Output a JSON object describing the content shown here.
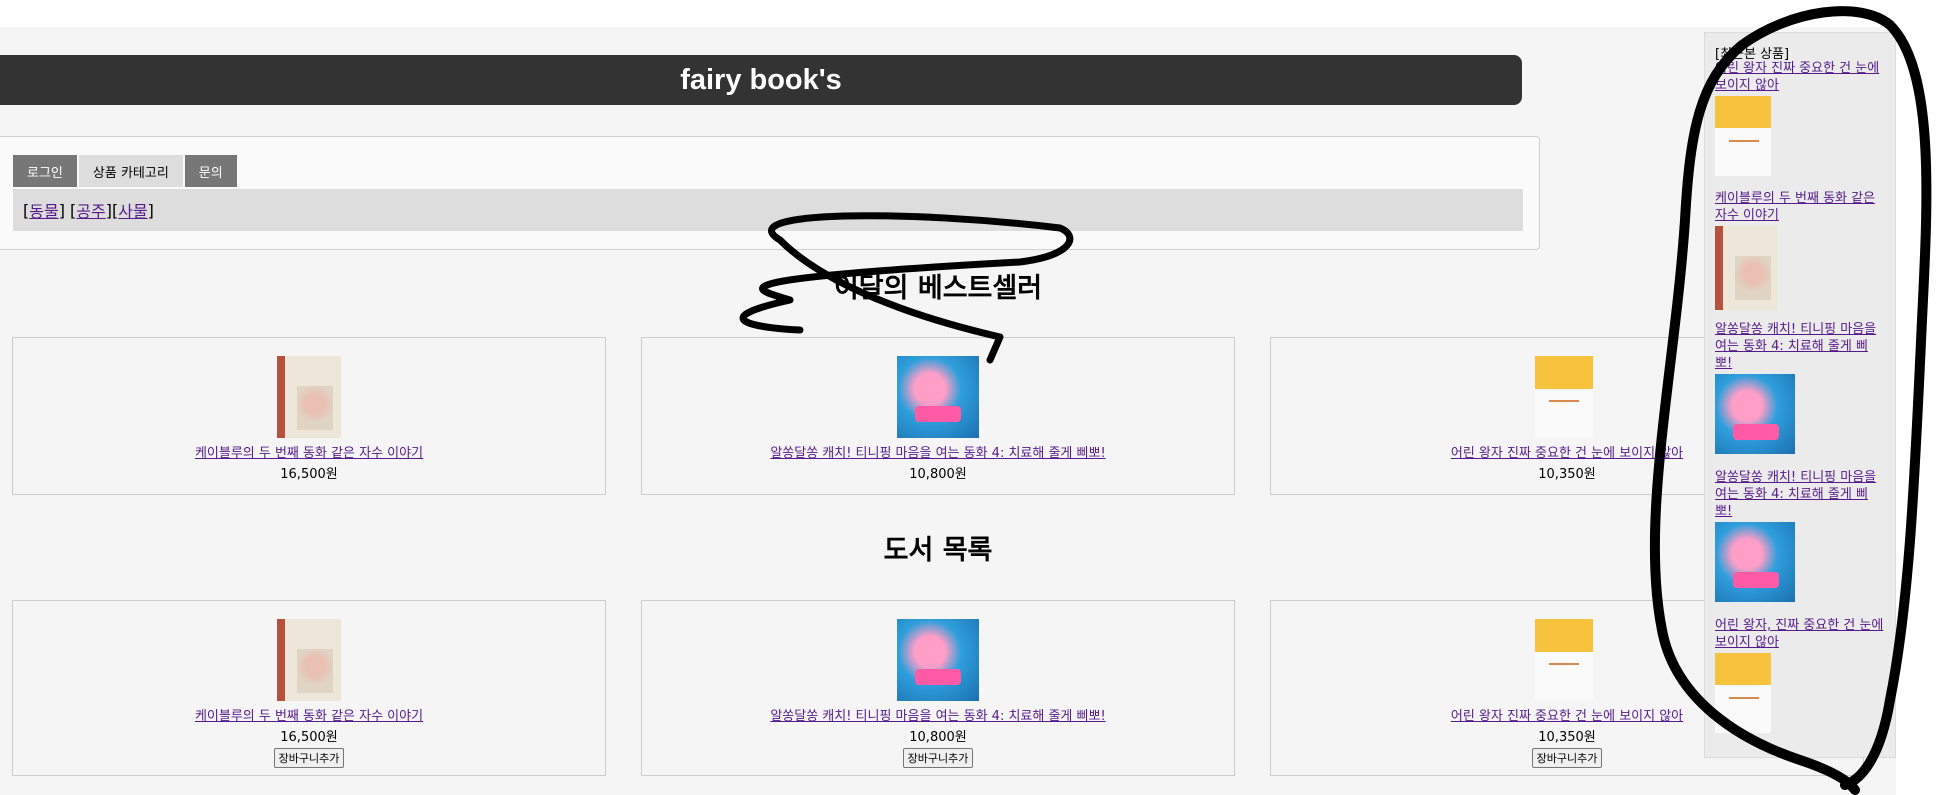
{
  "site": {
    "title": "fairy book's"
  },
  "tabs": [
    {
      "label": "로그인"
    },
    {
      "label": "상품 카테고리"
    },
    {
      "label": "문의"
    }
  ],
  "categories": {
    "prefix": "[",
    "item1": " 동물 ",
    "sep1": "] [",
    "item2": " 공주 ",
    "sep2": "][",
    "item3": " 사물 ",
    "suffix": "]"
  },
  "bestseller": {
    "heading": "이달의 베스트셀러",
    "items": [
      {
        "title": "케이블루의 두 번째 동화 같은 자수 이야기",
        "price": "16,500원",
        "cover": "embroidery-book-cover"
      },
      {
        "title": "알쏭달쏭 캐치! 티니핑 마음을 여는 동화 4: 치료해 줄게 삐뽀!",
        "price": "10,800원",
        "cover": "teenieping-book-cover"
      },
      {
        "title": "어린 왕자 진짜 중요한 건 눈에 보이지 않아",
        "price": "10,350원",
        "cover": "little-prince-book-cover"
      }
    ]
  },
  "catalog": {
    "heading": "도서 목록",
    "cart_label": "장바구니추가",
    "items": [
      {
        "title": "케이블루의 두 번째 동화 같은 자수 이야기",
        "price": "16,500원",
        "cover": "embroidery-book-cover"
      },
      {
        "title": "알쏭달쏭 캐치! 티니핑 마음을 여는 동화 4: 치료해 줄게 삐뽀!",
        "price": "10,800원",
        "cover": "teenieping-book-cover"
      },
      {
        "title": "어린 왕자 진짜 중요한 건 눈에 보이지 않아",
        "price": "10,350원",
        "cover": "little-prince-book-cover"
      }
    ]
  },
  "recent": {
    "heading": "[최근본 상품]",
    "items": [
      {
        "title": "어린 왕자 진짜 중요한 건 눈에 보이지 않아"
      },
      {
        "title": "케이블루의 두 번째 동화 같은 자수 이야기"
      },
      {
        "title": "알쏭달쏭 캐치! 티니핑 마음을 여는 동화 4: 치료해 줄게 삐뽀!"
      },
      {
        "title": "알쏭달쏭 캐치! 티니핑 마음을 여는 동화 4: 치료해 줄게 삐뽀!"
      },
      {
        "title": "어린 왕자, 진짜 중요한 건 눈에 보이지 않아"
      }
    ]
  },
  "colors": {
    "header_bg": "#333333",
    "link": "#551a8b",
    "annotation": "#000000"
  }
}
